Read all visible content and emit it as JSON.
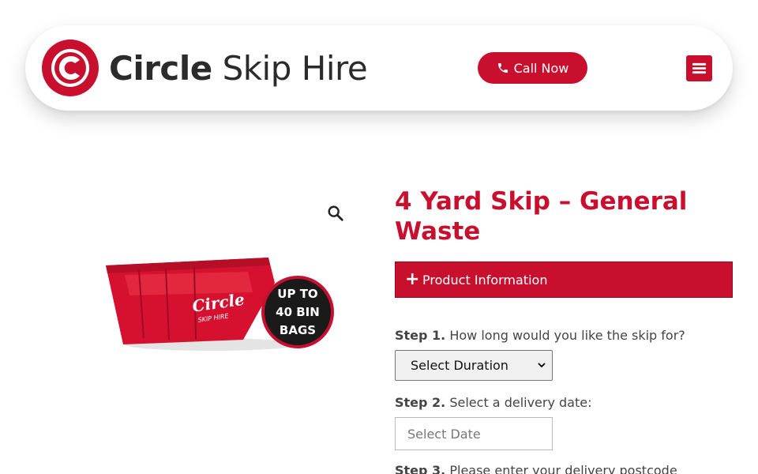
{
  "header": {
    "brand_bold": "Circle",
    "brand_light": "Skip Hire",
    "call_label": "Call Now"
  },
  "icons": {
    "phone": "phone-icon",
    "menu": "hamburger-menu-icon",
    "zoom": "magnifier-icon",
    "plus": "plus-icon"
  },
  "colors": {
    "brand_red": "#c8102e"
  },
  "product": {
    "title": "4 Yard Skip – General Waste",
    "image_badge": [
      "UP TO",
      "40 BIN",
      "BAGS"
    ],
    "image_skip_brand": "Circle",
    "image_skip_sub": "SKIP HIRE",
    "accordion_label": "Product Information"
  },
  "form": {
    "step1_label": "Step 1.",
    "step1_text": " How long would you like the skip for?",
    "duration_selected": "Select Duration",
    "step2_label": "Step 2.",
    "step2_text": " Select a delivery date:",
    "date_placeholder": "Select Date",
    "step3_label": "Step 3.",
    "step3_text": " Please enter your delivery postcode"
  }
}
